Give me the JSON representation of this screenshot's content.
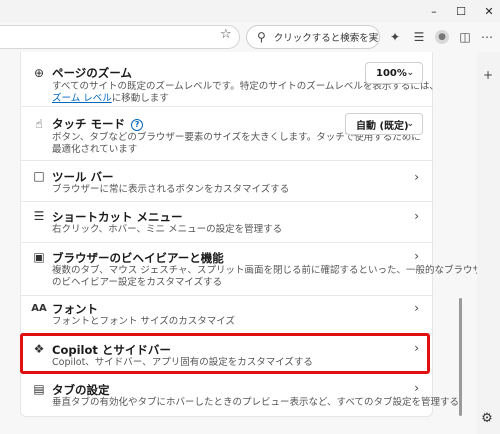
{
  "search": {
    "placeholder": "クリックすると検索を実..."
  },
  "settings": {
    "zoom": {
      "title": "ページのズーム",
      "desc_line1": "すべてのサイトの既定のズームレベルです。特定のサイトのズームレベルを表示するには、",
      "link": "ズーム レベル",
      "desc_line2_rest": "に移動します",
      "value": "100%"
    },
    "touch": {
      "title": "タッチ モード",
      "desc_line1": "ボタン、タブなどのブラウザー要素のサイズを大きくします。タッチで使用するために",
      "desc_line2": "最適化されています",
      "value": "自動 (既定)"
    },
    "toolbar": {
      "title": "ツール バー",
      "desc": "ブラウザーに常に表示されるボタンをカスタマイズする"
    },
    "context_menu": {
      "title": "ショートカット メニュー",
      "desc": "右クリック、ホバー、ミニ メニューの設定を管理する"
    },
    "behavior": {
      "title": "ブラウザーのビヘイビアーと機能",
      "desc_line1": "複数のタブ、マウス ジェスチャ、スプリット画面を閉じる前に確認するといった、一般的なブラウザー",
      "desc_line2": "のビヘイビアー設定をカスタマイズする"
    },
    "fonts": {
      "title": "フォント",
      "desc": "フォントとフォント サイズのカスタマイズ"
    },
    "copilot": {
      "title": "Copilot とサイドバー",
      "desc": "Copilot、サイドバー、アプリ固有の設定をカスタマイズする"
    },
    "tabs": {
      "title": "タブの設定",
      "desc": "垂直タブの有効化やタブにホバーしたときのプレビュー表示など、すべてのタブ設定を管理する"
    }
  },
  "colors": {
    "highlight": "#e01010",
    "link": "#0067c0"
  }
}
